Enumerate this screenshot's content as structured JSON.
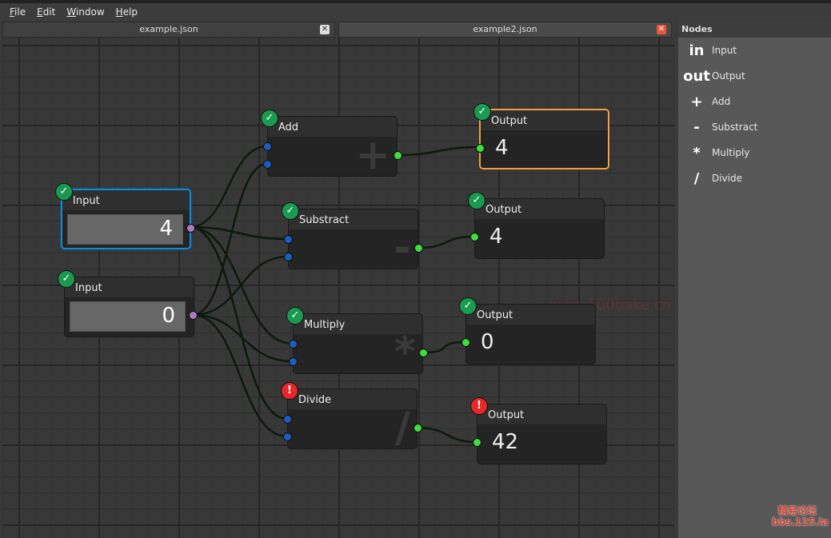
{
  "menu": [
    "File",
    "Edit",
    "Window",
    "Help"
  ],
  "tabs": [
    {
      "label": "example.json",
      "close": "✕",
      "active": false
    },
    {
      "label": "example2.json",
      "close": "✕",
      "active": true
    }
  ],
  "sidebar": {
    "title": "Nodes",
    "items": [
      {
        "glyph": "in",
        "label": "Input"
      },
      {
        "glyph": "out",
        "label": "Output"
      },
      {
        "glyph": "+",
        "label": "Add"
      },
      {
        "glyph": "-",
        "label": "Substract"
      },
      {
        "glyph": "*",
        "label": "Multiply"
      },
      {
        "glyph": "/",
        "label": "Divide"
      }
    ]
  },
  "colors": {
    "ok": "#1a9a50",
    "error": "#e52828",
    "selected_output": "#f0a040",
    "selected_input": "#1b86c8",
    "input_port": "#1a5fc0",
    "output_port": "#3ede3e",
    "value_port": "#b07ac0"
  },
  "nodes": [
    {
      "id": "in1",
      "type": "input",
      "title": "Input",
      "value": "4",
      "status": "ok",
      "selected": true
    },
    {
      "id": "in2",
      "type": "input",
      "title": "Input",
      "value": "0",
      "status": "ok"
    },
    {
      "id": "add",
      "type": "op",
      "title": "Add",
      "glyph": "+",
      "status": "ok"
    },
    {
      "id": "sub",
      "type": "op",
      "title": "Substract",
      "glyph": "-",
      "status": "ok"
    },
    {
      "id": "mul",
      "type": "op",
      "title": "Multiply",
      "glyph": "*",
      "status": "ok"
    },
    {
      "id": "div",
      "type": "op",
      "title": "Divide",
      "glyph": "/",
      "status": "error"
    },
    {
      "id": "out1",
      "type": "output",
      "title": "Output",
      "value": "4",
      "status": "ok",
      "selected": true
    },
    {
      "id": "out2",
      "type": "output",
      "title": "Output",
      "value": "4",
      "status": "ok"
    },
    {
      "id": "out3",
      "type": "output",
      "title": "Output",
      "value": "0",
      "status": "ok"
    },
    {
      "id": "out4",
      "type": "output",
      "title": "Output",
      "value": "42",
      "status": "error"
    }
  ],
  "connections": [
    [
      "in1",
      "add",
      0
    ],
    [
      "in1",
      "sub",
      0
    ],
    [
      "in1",
      "mul",
      0
    ],
    [
      "in1",
      "div",
      0
    ],
    [
      "in2",
      "add",
      1
    ],
    [
      "in2",
      "sub",
      1
    ],
    [
      "in2",
      "mul",
      1
    ],
    [
      "in2",
      "div",
      1
    ],
    [
      "add",
      "out1",
      0
    ],
    [
      "sub",
      "out2",
      0
    ],
    [
      "mul",
      "out3",
      0
    ],
    [
      "div",
      "out4",
      0
    ]
  ],
  "watermarks": [
    "www.100bake.cn",
    "精易论坛 bbs.125.la"
  ]
}
